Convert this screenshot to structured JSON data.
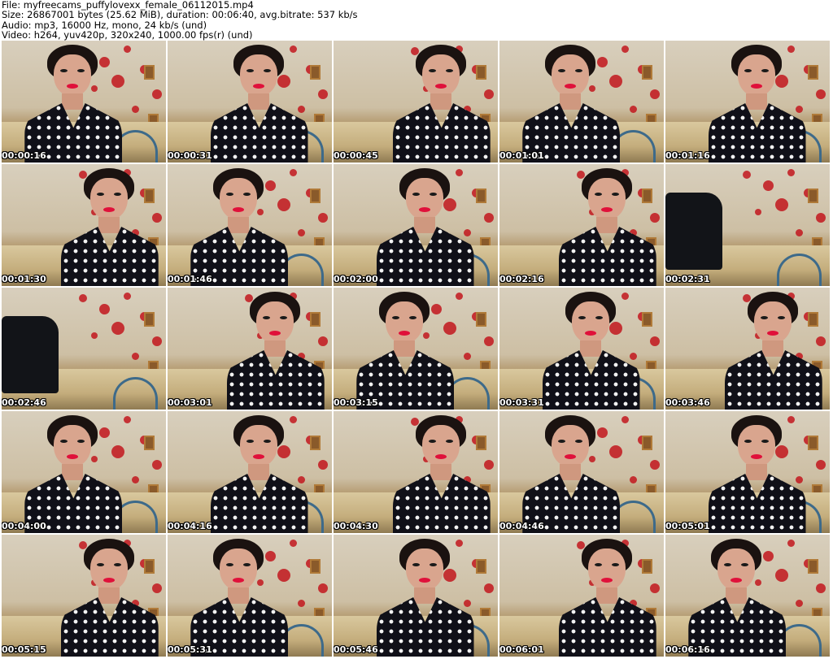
{
  "header": {
    "file_line": "File: myfreecams_puffylovexx_female_06112015.mp4",
    "size_line": "Size: 26867001 bytes (25.62 MiB), duration: 00:06:40, avg.bitrate: 537 kb/s",
    "audio_line": "Audio: mp3, 16000 Hz, mono, 24 kb/s (und)",
    "video_line": "Video: h264, yuv420p, 320x240, 1000.00 fps(r) (und)"
  },
  "thumbnails": [
    {
      "timestamp": "00:00:16",
      "scene": "person"
    },
    {
      "timestamp": "00:00:31",
      "scene": "person"
    },
    {
      "timestamp": "00:00:45",
      "scene": "person"
    },
    {
      "timestamp": "00:01:01",
      "scene": "person"
    },
    {
      "timestamp": "00:01:16",
      "scene": "person"
    },
    {
      "timestamp": "00:01:30",
      "scene": "person"
    },
    {
      "timestamp": "00:01:46",
      "scene": "person"
    },
    {
      "timestamp": "00:02:00",
      "scene": "person"
    },
    {
      "timestamp": "00:02:16",
      "scene": "person"
    },
    {
      "timestamp": "00:02:31",
      "scene": "empty-chair"
    },
    {
      "timestamp": "00:02:46",
      "scene": "empty-chair"
    },
    {
      "timestamp": "00:03:01",
      "scene": "person"
    },
    {
      "timestamp": "00:03:15",
      "scene": "person"
    },
    {
      "timestamp": "00:03:31",
      "scene": "person"
    },
    {
      "timestamp": "00:03:46",
      "scene": "person"
    },
    {
      "timestamp": "00:04:00",
      "scene": "person"
    },
    {
      "timestamp": "00:04:16",
      "scene": "person"
    },
    {
      "timestamp": "00:04:30",
      "scene": "person"
    },
    {
      "timestamp": "00:04:46",
      "scene": "person"
    },
    {
      "timestamp": "00:05:01",
      "scene": "person"
    },
    {
      "timestamp": "00:05:15",
      "scene": "person"
    },
    {
      "timestamp": "00:05:31",
      "scene": "person"
    },
    {
      "timestamp": "00:05:46",
      "scene": "person"
    },
    {
      "timestamp": "00:06:01",
      "scene": "person"
    },
    {
      "timestamp": "00:06:16",
      "scene": "person"
    }
  ],
  "colors": {
    "background": "#ffffff",
    "timestamp_text": "#ffffff",
    "timestamp_outline": "#000000",
    "wall_hearts": "#c2161d",
    "chair_frame": "#3d6a8a"
  }
}
